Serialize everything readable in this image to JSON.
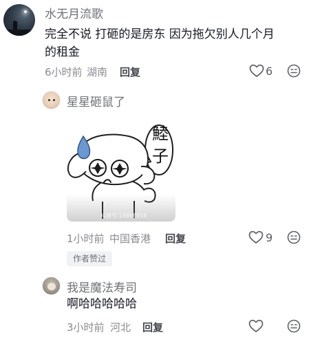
{
  "comments": [
    {
      "username": "水无月流歌",
      "text_line1": "完全不说 打砸的是房东  因为拖欠别人几个月",
      "text_line2": "的租金",
      "time": "6小时前",
      "location": "湖南",
      "reply_label": "回复",
      "likes": "6"
    },
    {
      "username": "星星砸鼠了",
      "sticker_text": "鯥子",
      "sticker_watermark": "抖音号 19866918",
      "time": "1小时前",
      "location": "中国香港",
      "reply_label": "回复",
      "likes": "9",
      "author_badge": "作者赞过"
    },
    {
      "username": "我是魔法寿司",
      "text": "啊哈哈哈哈哈",
      "time": "3小时前",
      "location": "河北",
      "reply_label": "回复"
    }
  ],
  "icons": {
    "like": "heart-icon",
    "dislike": "sad-face-icon"
  }
}
